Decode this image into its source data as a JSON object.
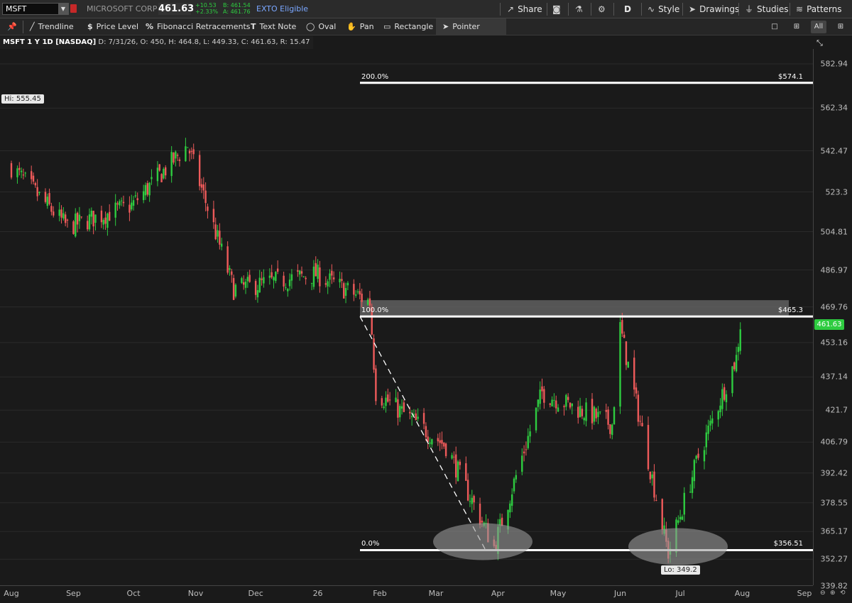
{
  "header": {
    "symbol": "MSFT",
    "company": "MICROSOFT CORP",
    "last_price": "461.63",
    "change": "+10.53",
    "change_pct": "+2.33%",
    "bid": "B: 461.54",
    "ask": "A: 461.76",
    "exto": "EXTO Eligible",
    "share_label": "Share",
    "aggregation": "D",
    "style_label": "Style",
    "drawings_label": "Drawings",
    "studies_label": "Studies",
    "patterns_label": "Patterns"
  },
  "drawing_tools": [
    {
      "label": "Trendline",
      "icon": "trendline-icon",
      "glyph": "╱"
    },
    {
      "label": "Price Level",
      "icon": "dollar-icon",
      "glyph": "$"
    },
    {
      "label": "Fibonacci Retracements",
      "icon": "percent-icon",
      "glyph": "%"
    },
    {
      "label": "Text Note",
      "icon": "text-icon",
      "glyph": "T"
    },
    {
      "label": "Oval",
      "icon": "oval-icon",
      "glyph": "◯"
    },
    {
      "label": "Pan",
      "icon": "hand-icon",
      "glyph": "✋"
    },
    {
      "label": "Rectangle",
      "icon": "rectangle-icon",
      "glyph": "▭"
    },
    {
      "label": "Pointer",
      "icon": "cursor-icon",
      "glyph": "➤"
    }
  ],
  "right_toggles": [
    "□",
    "⊞",
    "All",
    "⊞"
  ],
  "info": {
    "title": "MSFT 1 Y 1D [NASDAQ]",
    "date": "D: 7/31/26",
    "open": "O: 450",
    "high": "H: 464.8",
    "low": "L: 449.33",
    "close": "C: 461.63",
    "range": "R: 15.47"
  },
  "colors": {
    "up": "#2ecc40",
    "down": "#ee5a5a",
    "background": "#1a1a1a",
    "fib_line": "#ffffff"
  },
  "annotations": {
    "hi_label": "Hi: 555.45",
    "lo_label": "Lo: 349.2",
    "price_tag": "461.63"
  },
  "chart_data": {
    "type": "candlestick",
    "xlabels": [
      "Aug",
      "Sep",
      "Oct",
      "Nov",
      "Dec",
      "26",
      "Feb",
      "Mar",
      "Apr",
      "May",
      "Jun",
      "Jul",
      "Aug",
      "Sep"
    ],
    "ylabels": [
      "582.94",
      "562.34",
      "542.47",
      "523.3",
      "504.81",
      "486.97",
      "469.76",
      "453.16",
      "437.14",
      "421.7",
      "406.79",
      "392.42",
      "378.55",
      "365.17",
      "352.27",
      "339.82"
    ],
    "ylim": [
      339.82,
      582.94
    ],
    "hi": 555.45,
    "lo": 349.2,
    "fib_levels": [
      {
        "pct": "200.0%",
        "price": 574.1,
        "label": "$574.1"
      },
      {
        "pct": "100.0%",
        "price": 465.3,
        "label": "$465.3"
      },
      {
        "pct": "0.0%",
        "price": 356.51,
        "label": "$356.51"
      }
    ],
    "key_closes": [
      {
        "date": "2025-08-01",
        "price": 535
      },
      {
        "date": "2025-08-29",
        "price": 507
      },
      {
        "date": "2025-09-30",
        "price": 517
      },
      {
        "date": "2025-10-28",
        "price": 545
      },
      {
        "date": "2025-11-20",
        "price": 478
      },
      {
        "date": "2025-12-31",
        "price": 485
      },
      {
        "date": "2026-01-27",
        "price": 472
      },
      {
        "date": "2026-01-30",
        "price": 430
      },
      {
        "date": "2026-03-06",
        "price": 405
      },
      {
        "date": "2026-03-30",
        "price": 358
      },
      {
        "date": "2026-04-23",
        "price": 430
      },
      {
        "date": "2026-05-28",
        "price": 415
      },
      {
        "date": "2026-06-01",
        "price": 460
      },
      {
        "date": "2026-06-25",
        "price": 355
      },
      {
        "date": "2026-07-10",
        "price": 400
      },
      {
        "date": "2026-07-29",
        "price": 446
      },
      {
        "date": "2026-07-31",
        "price": 461.63
      }
    ]
  }
}
